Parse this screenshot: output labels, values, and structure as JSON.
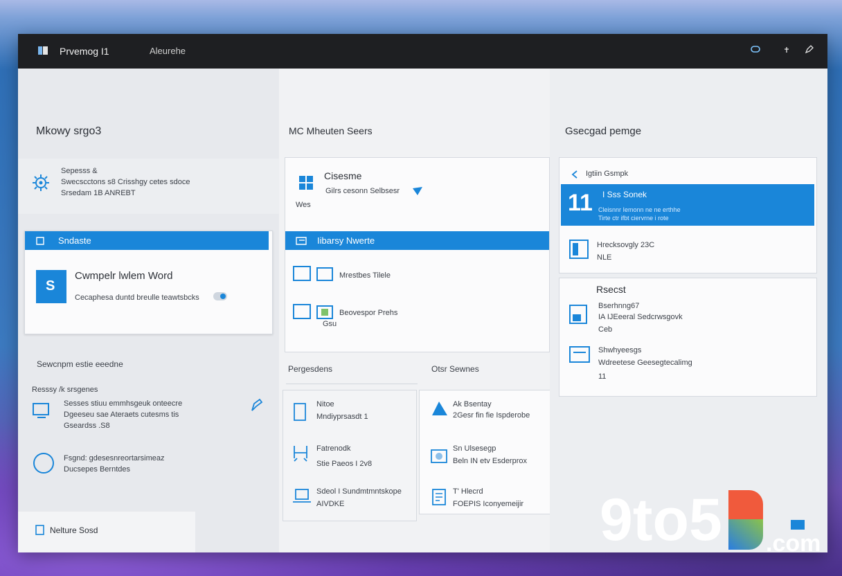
{
  "titlebar": {
    "app_title": "Prvemog I1",
    "subtitle": "Aleurehe"
  },
  "col1": {
    "heading": "Mkowy srgo3",
    "settings_card": {
      "line1": "Sepesss &",
      "line2": "Swecscctons s8 Crisshgy cetes sdoce",
      "line3": "Srsedam 1B ANREBT"
    },
    "selected_bar": "Sndaste",
    "word_card": {
      "title": "Cwmpelr lwlem Word",
      "desc": "Cecaphesa duntd breulle teawtsbcks"
    },
    "section2_label": "Sewcnpm estie eeedne",
    "item1": {
      "title": "Resssy /k srsgenes",
      "line1": "Sesses stiuu emmhsgeuk onteecre",
      "line2": "Dgeeseu sae Ateraets cutesms tis",
      "line3": "Gseardss .S8"
    },
    "item2": {
      "line1": "Fsgnd: gdesesnreortarsimeaz",
      "line2": "Ducsepes Berntdes"
    },
    "footer_label": "Nelture Sosd"
  },
  "col2": {
    "heading": "MC Mheuten Seers",
    "top_card": {
      "title": "Cisesme",
      "line1": "Gilrs cesonn Selbsesr",
      "line2": "Wes"
    },
    "selected_bar": "Iibarsy Nwerte",
    "row1": "Mrestbes Tilele",
    "row2": "Beovespor Prehs",
    "row2_sub": "Gsu",
    "section_left": "Pergesdens",
    "section_right": "Otsr Sewnes",
    "left_items": [
      {
        "title": "Nitoe",
        "sub": "Mndiyprsasdt 1"
      },
      {
        "title": "Fatrenodk",
        "sub": "Stie Paeos I 2v8"
      },
      {
        "title": "Sdeol I Sundmtmntskope",
        "sub": "AIVDKE"
      }
    ],
    "right_items": [
      {
        "title": "Ak Bsentay",
        "sub": "2Gesr fin fie Ispderobe"
      },
      {
        "title": "Sn Ulsesegp",
        "sub": "Beln IN etv Esderprox"
      },
      {
        "title": "T' Hlecrd",
        "sub": "FOEPIS Iconyemeijir"
      }
    ]
  },
  "col3": {
    "heading": "Gsecgad pemge",
    "panel_header": "Igtiin Gsmpk",
    "highlight": {
      "number": "11",
      "title": "I Sss Sonek",
      "line1": "Cleisnnr Iemonn ne ne erthhe",
      "line2": "Tirte ctr ifbt ciervrne i rote"
    },
    "doc_item": {
      "title": "Hrecksovgly 23C",
      "sub": "NLE"
    },
    "recent_heading": "Rsecst",
    "recent_items": [
      {
        "title": "Bserhnng67",
        "sub": "IA IJEeeral Sedcrwsgovk",
        "extra": "Ceb"
      },
      {
        "title": "Shwhyeesgs",
        "sub": "Wdreetese Geesegtecalimg",
        "extra": "11"
      }
    ]
  },
  "colors": {
    "accent": "#1a86d9",
    "titlebar": "#1e1f22"
  }
}
